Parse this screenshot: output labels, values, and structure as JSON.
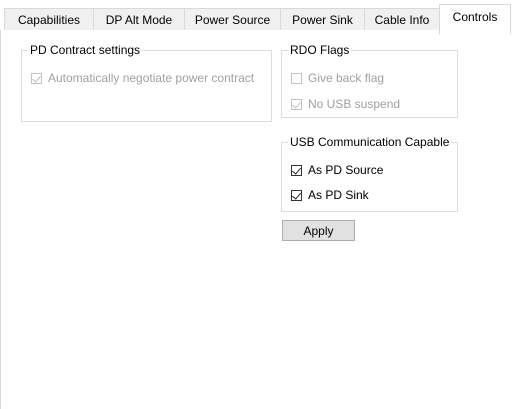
{
  "tabs": [
    {
      "label": "Capabilities",
      "active": false
    },
    {
      "label": "DP Alt Mode",
      "active": false
    },
    {
      "label": "Power Source",
      "active": false
    },
    {
      "label": "Power Sink",
      "active": false
    },
    {
      "label": "Cable Info",
      "active": false
    },
    {
      "label": "Controls",
      "active": true
    }
  ],
  "pd_contract": {
    "title": "PD Contract settings",
    "auto_negotiate": {
      "label": "Automatically negotiate power contract",
      "checked": true,
      "enabled": false
    }
  },
  "rdo_flags": {
    "title": "RDO Flags",
    "give_back": {
      "label": "Give back flag",
      "checked": false,
      "enabled": false
    },
    "no_usb_suspend": {
      "label": "No USB suspend",
      "checked": true,
      "enabled": false
    }
  },
  "usb_comm": {
    "title": "USB Communication Capable",
    "as_pd_source": {
      "label": "As PD Source",
      "checked": true,
      "enabled": true
    },
    "as_pd_sink": {
      "label": "As PD Sink",
      "checked": true,
      "enabled": true
    }
  },
  "apply_label": "Apply"
}
